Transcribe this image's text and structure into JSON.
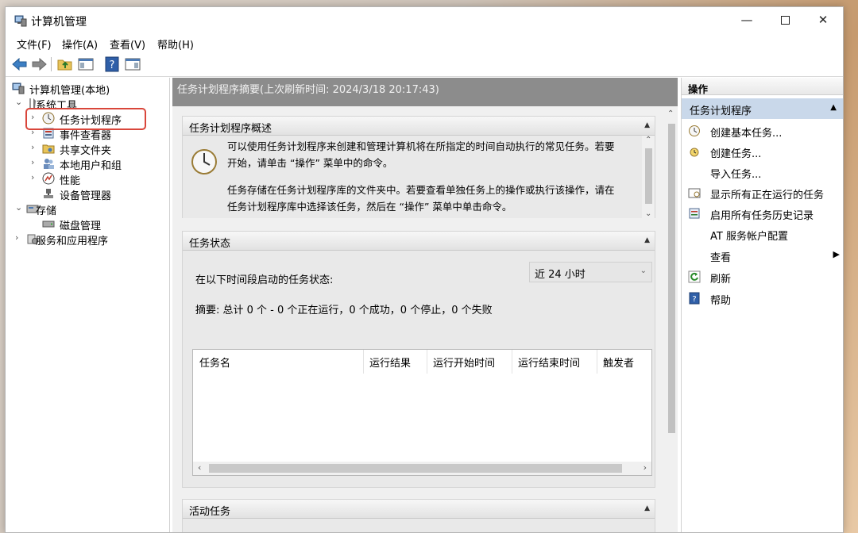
{
  "window": {
    "title": "计算机管理"
  },
  "menu": [
    "文件(F)",
    "操作(A)",
    "查看(V)",
    "帮助(H)"
  ],
  "tree": {
    "root": "计算机管理(本地)",
    "items": [
      {
        "label": "系统工具"
      },
      {
        "label": "任务计划程序"
      },
      {
        "label": "事件查看器"
      },
      {
        "label": "共享文件夹"
      },
      {
        "label": "本地用户和组"
      },
      {
        "label": "性能"
      },
      {
        "label": "设备管理器"
      },
      {
        "label": "存储"
      },
      {
        "label": "磁盘管理"
      },
      {
        "label": "服务和应用程序"
      }
    ]
  },
  "main": {
    "header": "任务计划程序摘要(上次刷新时间: 2024/3/18 20:17:43)",
    "overview": {
      "title": "任务计划程序概述",
      "line1": "可以使用任务计划程序来创建和管理计算机将在所指定的时间自动执行的常见任务。若要",
      "line2": "开始，请单击 “操作” 菜单中的命令。",
      "line3": "任务存储在任务计划程序库的文件夹中。若要查看单独任务上的操作或执行该操作，请在",
      "line4": "任务计划程序库中选择该任务，然后在 “操作” 菜单中单击命令。"
    },
    "status": {
      "title": "任务状态",
      "label": "在以下时间段启动的任务状态:",
      "period": "近 24 小时",
      "summary": "摘要: 总计 0 个 - 0 个正在运行，0 个成功，0 个停止，0 个失败",
      "columns": [
        "任务名",
        "运行结果",
        "运行开始时间",
        "运行结束时间",
        "触发者"
      ]
    },
    "active": {
      "title": "活动任务"
    }
  },
  "actions": {
    "title": "操作",
    "group": "任务计划程序",
    "items": [
      {
        "label": "创建基本任务...",
        "icon": "create-basic-task-icon"
      },
      {
        "label": "创建任务...",
        "icon": "create-task-icon"
      },
      {
        "label": "导入任务...",
        "icon": ""
      },
      {
        "label": "显示所有正在运行的任务",
        "icon": "running-tasks-icon"
      },
      {
        "label": "启用所有任务历史记录",
        "icon": "history-icon"
      },
      {
        "label": "AT 服务帐户配置",
        "icon": ""
      },
      {
        "label": "查看",
        "icon": ""
      },
      {
        "label": "刷新",
        "icon": "refresh-icon"
      },
      {
        "label": "帮助",
        "icon": "help-icon"
      }
    ]
  },
  "colors": {
    "accent_selection": "#c9d8ea",
    "highlight_border": "#d9463b",
    "header_gray": "#8c8c8c"
  }
}
